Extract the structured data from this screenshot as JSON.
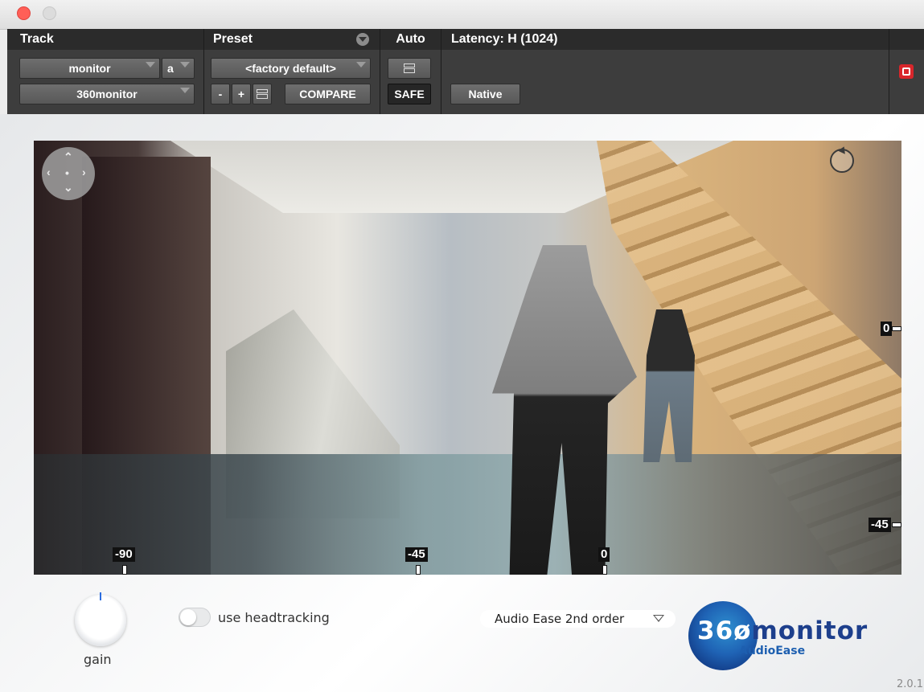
{
  "header": {
    "track_title": "Track",
    "preset_title": "Preset",
    "auto_title": "Auto",
    "latency_title": "Latency: H (1024)",
    "track_select": "monitor",
    "track_variant": "a",
    "insert_select": "360monitor",
    "preset_select": "<factory default>",
    "minus": "-",
    "plus": "+",
    "compare": "COMPARE",
    "safe": "SAFE",
    "native": "Native"
  },
  "viewer": {
    "markers_bottom": [
      "-90",
      "-45",
      "0"
    ],
    "markers_right": [
      "0",
      "-45"
    ]
  },
  "controls": {
    "gain_label": "gain",
    "headtracking_label": "use headtracking",
    "headtracking_on": false,
    "decoder_select": "Audio Ease 2nd order"
  },
  "branding": {
    "logo_prefix": "36",
    "logo_o": "ø",
    "logo_suffix": "monitor",
    "logo_sub": "AudioEase",
    "version": "2.0.1"
  },
  "colors": {
    "close": "#ff5f57",
    "header_bg": "#3d3d3d",
    "bypass": "#d8262b",
    "logo_blue": "#1d3f8c"
  }
}
